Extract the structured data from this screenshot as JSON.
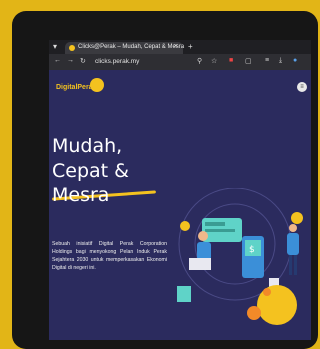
{
  "browser": {
    "tab_title": "Clicks@Perak – Mudah, Cepat & Mesra",
    "tab_close": "×",
    "new_tab": "+",
    "url": "clicks.perak.my",
    "nav": {
      "back": "←",
      "forward": "→",
      "reload": "↻"
    }
  },
  "site": {
    "logo_text": "DigitalPerak",
    "headline": [
      "Mudah,",
      "Cepat &",
      "Mesra"
    ],
    "description": "Sebuah inisiatif Digital Perak Corporation Holdings bagi menyokong Pelan Induk Perak Sejahtera 2030 untuk memperkasakan Ekonomi Digital di negeri ini."
  },
  "colors": {
    "accent": "#f4c21f",
    "page_bg": "#2b2b5e",
    "device_bg": "#e2b517"
  }
}
